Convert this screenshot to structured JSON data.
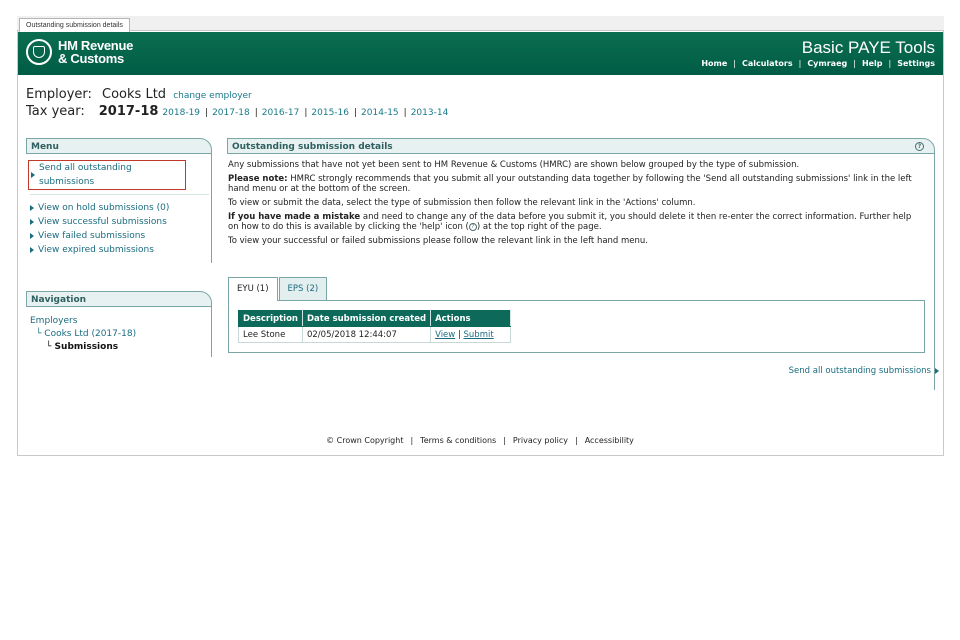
{
  "window": {
    "tab_title": "Outstanding submission details"
  },
  "header": {
    "logo_line1": "HM Revenue",
    "logo_line2": "& Customs",
    "app_title": "Basic PAYE Tools",
    "nav": [
      "Home",
      "Calculators",
      "Cymraeg",
      "Help",
      "Settings"
    ],
    "nav_separator": "|"
  },
  "employer": {
    "label": "Employer:",
    "name": "Cooks Ltd",
    "change_link": "change employer"
  },
  "tax_year": {
    "label": "Tax year:",
    "current": "2017-18",
    "years": [
      "2018-19",
      "2017-18",
      "2016-17",
      "2015-16",
      "2014-15",
      "2013-14"
    ],
    "separator": "|"
  },
  "menu": {
    "title": "Menu",
    "primary": "Send all outstanding submissions",
    "items": [
      "View on hold submissions (0)",
      "View successful submissions",
      "View failed submissions",
      "View expired submissions"
    ]
  },
  "navigation": {
    "title": "Navigation",
    "level1": "Employers",
    "level2": "└ Cooks Ltd (2017-18)",
    "level3": "└ Submissions"
  },
  "panel": {
    "title": "Outstanding submission details",
    "help_glyph": "?",
    "p1": "Any submissions that have not yet been sent to HM Revenue & Customs (HMRC) are shown below grouped by the type of submission.",
    "p2_bold": "Please note:",
    "p2": " HMRC strongly recommends that you submit all your outstanding data together by following the 'Send all outstanding submissions' link in the left hand menu or at the bottom of the screen.",
    "p3": "To view or submit the data, select the type of submission then follow the relevant link in the 'Actions' column.",
    "p4_bold": "If you have made a mistake",
    "p4a": " and need to change any of the data before you submit it, you should delete it then re-enter the correct information. Further help on how to do this is available by clicking the 'help' icon (",
    "p4b": ") at the top right of the page.",
    "p5": "To view your successful or failed submissions please follow the relevant link in the left hand menu."
  },
  "tabs": [
    {
      "label": "EYU (1)"
    },
    {
      "label": "EPS (2)"
    }
  ],
  "table": {
    "headers": [
      "Description",
      "Date submission created",
      "Actions"
    ],
    "rows": [
      {
        "description": "Lee Stone",
        "date": "02/05/2018 12:44:07",
        "action_view": "View",
        "action_sep": "|",
        "action_submit": "Submit"
      }
    ]
  },
  "send_all_link": "Send all outstanding submissions",
  "footer": {
    "items": [
      "© Crown Copyright",
      "Terms & conditions",
      "Privacy policy",
      "Accessibility"
    ],
    "separator": "|"
  },
  "colors": {
    "header_green": "#005c45",
    "link_teal": "#1a6c80",
    "table_header": "#0d6a5a"
  }
}
